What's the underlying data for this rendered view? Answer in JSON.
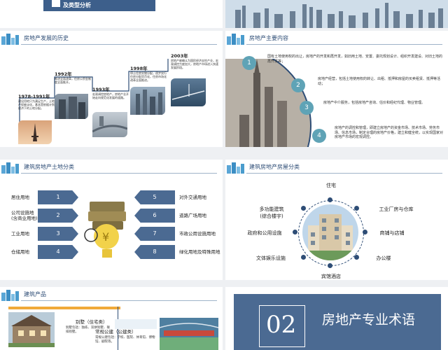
{
  "slide_top_left": {
    "subtitle": "及类型分析"
  },
  "slide1": {
    "title": "房地产发展的历史",
    "timeline": [
      {
        "year": "1978-1991年",
        "text": "建设用地只为满足生产，土地产权被淡化，基本是依据计划经济下的土地分配。"
      },
      {
        "year": "1992年",
        "text": "推进全面改革，住房公积金制度全面推开。"
      },
      {
        "year": "1993年",
        "text": "宏观调控房地产，房地产业开始走向规范化发展的道路。"
      },
      {
        "year": "1998年",
        "text": "停止住房实物分配，逐步实行住房分配货币化，住房市场化改革全面推进。"
      },
      {
        "year": "2003年",
        "text": "房地产被确认为国民经济支柱产业，宏观调控力度加大，房地产市场进入快速发展阶段。"
      }
    ]
  },
  "slide2": {
    "title": "房地产主要内容",
    "items": [
      {
        "num": "1",
        "text": "国有土地使用权的出让，房地产的开发和再开发，如旧用土地、安置、委托规划设计、组织开发建设、对旧土地的再开发等；"
      },
      {
        "num": "2",
        "text": "房地产经营，包括土地使用权的转让、出租、抵押和房屋的买卖租赁、抵押等活动；"
      },
      {
        "num": "3",
        "text": "房地产中介服务，包括房地产咨询、估价和经纪代理、物业管理。"
      },
      {
        "num": "4",
        "text": "房地产的调控和管理，即建立房地产的资金市场、技术市场、劳务市场、信息市场，制定合理的房地产价格，建立和健全统，以实现国家对房地产市场的宏观调控。"
      }
    ]
  },
  "slide3": {
    "title": "建筑房地产土地分类",
    "left": [
      {
        "label": "居住用地",
        "num": "1"
      },
      {
        "label": "公司设施地\n(含商业用地)",
        "num": "2"
      },
      {
        "label": "工业用地",
        "num": "3"
      },
      {
        "label": "仓储用地",
        "num": "4"
      }
    ],
    "right": [
      {
        "label": "对外交通用地",
        "num": "5"
      },
      {
        "label": "道路广场用地",
        "num": "6"
      },
      {
        "label": "市政公用设施用地",
        "num": "7"
      },
      {
        "label": "绿化用地及特殊用地",
        "num": "8"
      }
    ]
  },
  "slide4": {
    "title": "建筑房地产房屋分类",
    "categories": {
      "top": "住宅",
      "top_left": "多功能建筑\n(综合楼宇)",
      "top_right": "工业厂房与仓库",
      "mid_left": "政府和公用设施",
      "mid_right": "商铺与店铺",
      "bottom_left": "文体娱乐设施",
      "bottom_right": "办公楼",
      "bottom": "宾馆酒店"
    }
  },
  "slide5": {
    "title": "建筑产品",
    "item1_title": "别墅（住宅类）",
    "item1_desc": "别墅包括：独栋、双拼别墅、联排别墅。",
    "item2_title": "常规公建（公建类）",
    "item2_desc": "常规公建包括：学校、医院、体育馆、博物馆、剧院等。"
  },
  "slide6": {
    "number": "02",
    "title": "房地产专业术语"
  },
  "colors": {
    "navy": "#2e4d76",
    "teal": "#4a90a4",
    "slate": "#4b6a92"
  }
}
